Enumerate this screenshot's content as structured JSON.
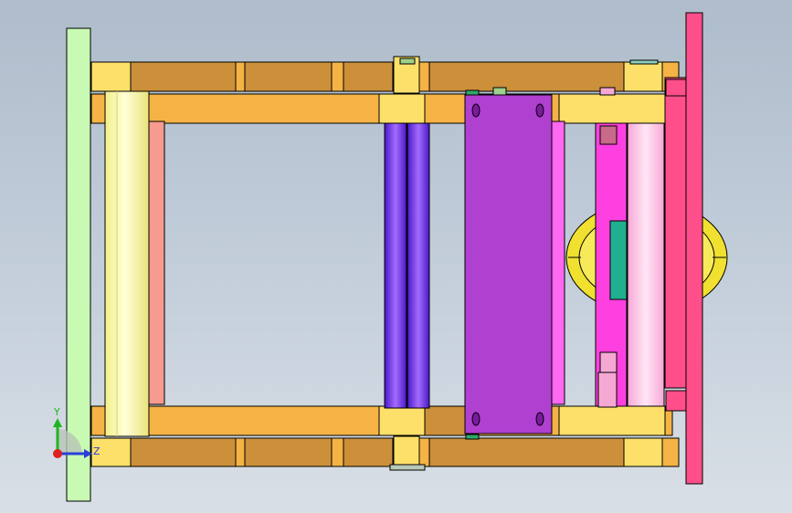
{
  "view": {
    "colors": {
      "background_top": "#aebccb",
      "background_bottom": "#d9dfe6",
      "fixed_plate": "#c8fab4",
      "moving_plate": "#ff4f8a",
      "rail_orange": "#f5b345",
      "rail_dark": "#cc8f3a",
      "guide_pillar": "#ffffaa",
      "purple_plate": "#b040d0",
      "blue_rod": "#7a2ff0",
      "magenta_plate": "#ff40e0",
      "yellow_disk": "#f0e030",
      "teal_block": "#20b090"
    }
  },
  "triad": {
    "y_label": "Y",
    "z_label": "Z"
  }
}
